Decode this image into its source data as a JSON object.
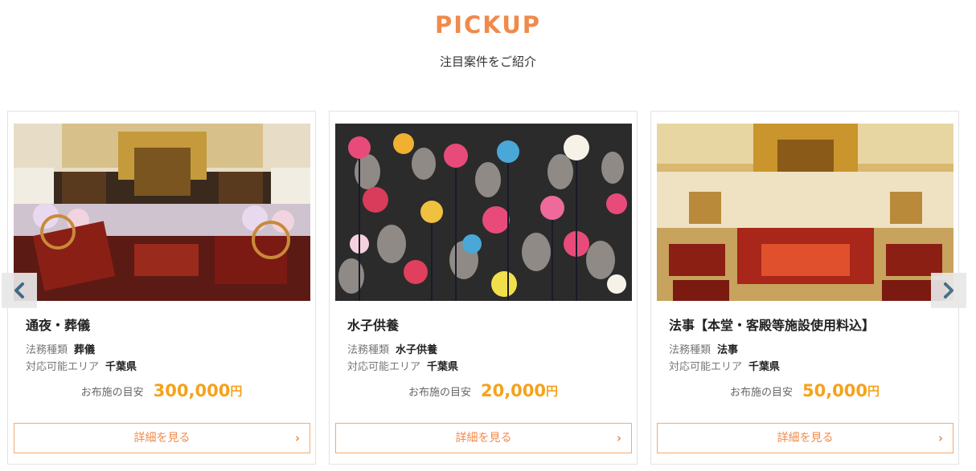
{
  "section": {
    "title": "PICKUP",
    "subtitle": "注目案件をご紹介"
  },
  "cards": [
    {
      "title": "通夜・葬儀",
      "service_type_label": "法務種類",
      "service_type_value": "葬儀",
      "area_label": "対応可能エリア",
      "area_value": "千葉県",
      "price_label": "お布施の目安",
      "price_amount": "300,000",
      "price_unit": "円",
      "button_label": "詳細を見る",
      "image_subject": "funeral-hall-altar-photo"
    },
    {
      "title": "水子供養",
      "service_type_label": "法務種類",
      "service_type_value": "水子供養",
      "area_label": "対応可能エリア",
      "area_value": "千葉県",
      "price_label": "お布施の目安",
      "price_amount": "20,000",
      "price_unit": "円",
      "button_label": "詳細を見る",
      "image_subject": "jizo-statues-pinwheels-photo"
    },
    {
      "title": "法事【本堂・客殿等施設使用料込】",
      "service_type_label": "法務種類",
      "service_type_value": "法事",
      "area_label": "対応可能エリア",
      "area_value": "千葉県",
      "price_label": "お布施の目安",
      "price_amount": "50,000",
      "price_unit": "円",
      "button_label": "詳細を見る",
      "image_subject": "temple-main-hall-photo"
    }
  ],
  "icons": {
    "prev": "chevron-left-icon",
    "next": "chevron-right-icon",
    "button_arrow": "chevron-right-icon"
  },
  "colors": {
    "accent_orange": "#f08a4b",
    "price_yellow": "#f5a21b",
    "card_border": "#e2e2e2",
    "button_border": "#f3a971",
    "nav_arrow": "#3f6f8f"
  }
}
